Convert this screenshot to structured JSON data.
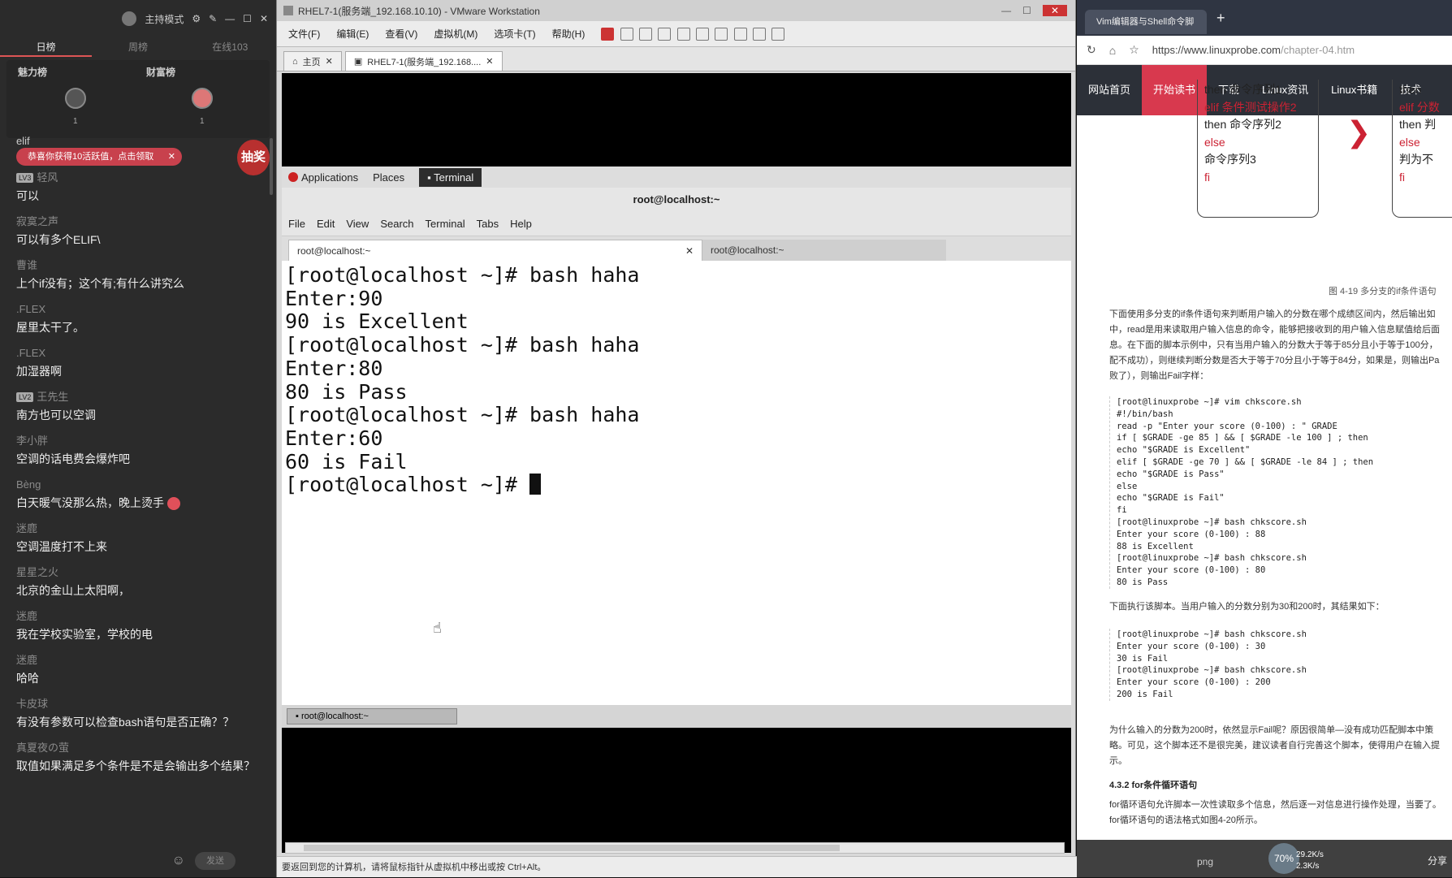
{
  "chat": {
    "host_mode": "主持模式",
    "tabs": [
      "日榜",
      "周榜",
      "在线103"
    ],
    "rank_labels": [
      "魅力榜",
      "财富榜"
    ],
    "rank_nums": [
      "1",
      "1"
    ],
    "partial_top": "elif",
    "notice": "恭喜你获得10活跃值，点击领取",
    "draw_label": "抽奖",
    "send_label": "发送",
    "messages": [
      {
        "nick": "轻风",
        "level": "LV3",
        "text": "可以"
      },
      {
        "nick": "寂寞之声",
        "level": "",
        "text": "可以有多个ELIF\\"
      },
      {
        "nick": "曹谁",
        "level": "",
        "text": "上个if没有；这个有;有什么讲究么"
      },
      {
        "nick": ".FLEX",
        "level": "",
        "text": "屋里太干了。"
      },
      {
        "nick": ".FLEX",
        "level": "",
        "text": "加湿器啊"
      },
      {
        "nick": "王先生",
        "level": "LV2",
        "text": "南方也可以空调"
      },
      {
        "nick": "李小胖",
        "level": "",
        "text": "空调的话电费会爆炸吧"
      },
      {
        "nick": "Bèng",
        "level": "",
        "text": "白天暖气没那么热，晚上烫手"
      },
      {
        "nick": "迷鹿",
        "level": "",
        "text": "空调温度打不上来"
      },
      {
        "nick": "星星之火",
        "level": "",
        "text": "北京的金山上太阳啊，"
      },
      {
        "nick": "迷鹿",
        "level": "",
        "text": "我在学校实验室，学校的电"
      },
      {
        "nick": "迷鹿",
        "level": "",
        "text": "哈哈"
      },
      {
        "nick": "卡皮球",
        "level": "",
        "text": "有没有参数可以检查bash语句是否正确？？"
      },
      {
        "nick": "真夏夜の萤",
        "level": "",
        "text": "取值如果满足多个条件是不是会输出多个结果？"
      }
    ]
  },
  "vmware": {
    "title": "RHEL7-1(服务端_192.168.10.10) - VMware Workstation",
    "menu": [
      "文件(F)",
      "编辑(E)",
      "查看(V)",
      "虚拟机(M)",
      "选项卡(T)",
      "帮助(H)"
    ],
    "tabs": [
      "主页",
      "RHEL7-1(服务端_192.168...."
    ],
    "status": "要返回到您的计算机，请将鼠标指针从虚拟机中移出或按 Ctrl+Alt。"
  },
  "gnome": {
    "applications": "Applications",
    "places": "Places",
    "terminal": "Terminal",
    "taskbar_item": "root@localhost:~"
  },
  "terminal": {
    "title": "root@localhost:~",
    "menu": [
      "File",
      "Edit",
      "View",
      "Search",
      "Terminal",
      "Tabs",
      "Help"
    ],
    "tab1": "root@localhost:~",
    "tab2": "root@localhost:~",
    "lines": [
      "[root@localhost ~]# bash haha",
      "Enter:90",
      "90 is Excellent",
      "[root@localhost ~]# bash haha",
      "Enter:80",
      "80 is Pass",
      "[root@localhost ~]# bash haha",
      "Enter:60",
      "60 is Fail"
    ],
    "prompt": "[root@localhost ~]# "
  },
  "browser": {
    "tab_title": "Vim编辑器与Shell命令脚",
    "url_host": "https://www.linuxprobe.com",
    "url_path": "/chapter-04.htm",
    "site_nav": [
      "网站首页",
      "开始读书",
      "下载",
      "Linux资讯",
      "Linux书籍",
      "技术"
    ],
    "flow_left": [
      "then 命令序列1",
      "elif 条件测试操作2",
      "then 命令序列2",
      "else",
      "命令序列3",
      "fi"
    ],
    "flow_right": [
      "then",
      "elif 分数",
      "then 判",
      "else",
      "判为不",
      "fi"
    ],
    "caption": "图 4-19 多分支的if条件语句",
    "para1": "下面使用多分支的if条件语句来判断用户输入的分数在哪个成绩区间内，然后输出如中，read是用来读取用户输入信息的命令，能够把接收到的用户输入信息赋值给后面息。在下面的脚本示例中，只有当用户输入的分数大于等于85分且小于等于100分，配不成功），则继续判断分数是否大于等于70分且小于等于84分，如果是，则输出Pa败了），则输出Fail字样：",
    "code1": "[root@linuxprobe ~]# vim chkscore.sh\n#!/bin/bash\nread -p \"Enter your score (0-100) : \" GRADE\nif [ $GRADE -ge 85 ] && [ $GRADE -le 100 ] ; then\necho \"$GRADE is Excellent\"\nelif [ $GRADE -ge 70 ] && [ $GRADE -le 84 ] ; then\necho \"$GRADE is Pass\"\nelse\necho \"$GRADE is Fail\"\nfi\n[root@linuxprobe ~]# bash chkscore.sh\nEnter your score (0-100) : 88\n88 is Excellent\n[root@linuxprobe ~]# bash chkscore.sh\nEnter your score (0-100) : 80\n80 is Pass",
    "para2": "下面执行该脚本。当用户输入的分数分别为30和200时，其结果如下：",
    "code2": "[root@linuxprobe ~]# bash chkscore.sh\nEnter your score (0-100) : 30\n30 is Fail\n[root@linuxprobe ~]# bash chkscore.sh\nEnter your score (0-100) : 200\n200 is Fail",
    "para3": "为什么输入的分数为200时，依然显示Fail呢？原因很简单—没有成功匹配脚本中策略。可见，这个脚本还不是很完美，建议读者自行完善这个脚本，使得用户在输入提示。",
    "heading": "4.3.2 for条件循环语句",
    "para4": "for循环语句允许脚本一次性读取多个信息，然后逐一对信息进行操作处理，当要了。for循环语句的语法格式如图4-20所示。",
    "png": "png",
    "percent": "70%",
    "up": "29.2K/s",
    "down": "2.3K/s",
    "share": "分享"
  }
}
